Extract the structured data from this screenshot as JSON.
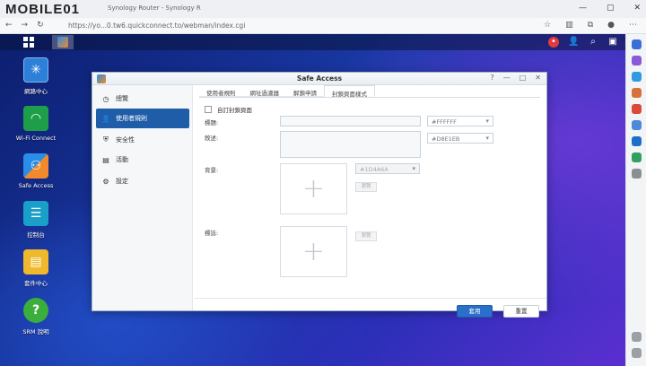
{
  "browser": {
    "logo": "MOBILE01",
    "tab_title": "Synology Router - Synology R",
    "url": "https://yo...0.tw6.quickconnect.to/webman/index.cgi",
    "min": "—",
    "max": "▢",
    "close": "✕"
  },
  "desktop": {
    "icons": [
      {
        "label": "網路中心",
        "icon": "network-center-icon",
        "color": "#2d7fd8"
      },
      {
        "label": "Wi-Fi Connect",
        "icon": "wifi-icon",
        "color": "#1f9e4a"
      },
      {
        "label": "Safe Access",
        "icon": "safe-access-icon",
        "color": "#2a8ee8"
      },
      {
        "label": "控制台",
        "icon": "control-panel-icon",
        "color": "#1aa0c8"
      },
      {
        "label": "套件中心",
        "icon": "package-center-icon",
        "color": "#f0b82c"
      },
      {
        "label": "SRM 說明",
        "icon": "help-icon",
        "color": "#3cae3c"
      }
    ]
  },
  "window": {
    "title": "Safe Access",
    "ctl_help": "?",
    "ctl_min": "—",
    "ctl_max": "□",
    "ctl_close": "✕",
    "sidebar": [
      {
        "label": "總覽",
        "icon": "overview-icon"
      },
      {
        "label": "使用者規則",
        "icon": "user-icon"
      },
      {
        "label": "安全性",
        "icon": "shield-icon"
      },
      {
        "label": "活動",
        "icon": "activity-icon"
      },
      {
        "label": "設定",
        "icon": "gear-icon"
      }
    ],
    "tabs": [
      "使用者規則",
      "網址過濾器",
      "解鎖申請",
      "封鎖頁面樣式"
    ],
    "active_tab": 3,
    "form": {
      "custom_checkbox": "自訂封鎖頁面",
      "title_label": "標題:",
      "desc_label": "敘述:",
      "bg_label": "背景:",
      "logo_label": "標誌:",
      "title_color": "#FFFFFF",
      "desc_color": "#D8E1EB",
      "bg_color": "#1D4A6A",
      "browse": "瀏覽",
      "plus": "+"
    },
    "apply": "套用",
    "reset": "重置"
  }
}
